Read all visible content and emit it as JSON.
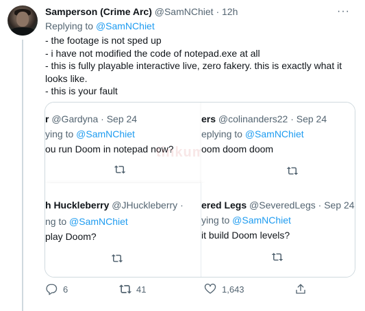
{
  "tweet": {
    "author_name": "Samperson (Crime Arc)",
    "author_handle": "@SamNChiet",
    "separator": "·",
    "time": "12h",
    "more": "···",
    "replying_prefix": "Replying to",
    "replying_mention": "@SamNChiet",
    "body_lines": [
      "- the footage is not sped up",
      "- i have not modified the code of notepad.exe at all",
      "- this is fully playable interactive live, zero fakery. this is exactly what it looks like.",
      "- this is your fault"
    ]
  },
  "media": {
    "watermark": "tinkum",
    "quotes": [
      {
        "author": "r",
        "handle": "@Gardyna",
        "date": "· Sep 24",
        "replying": "ying to",
        "mention": "@SamNChiet",
        "text": "ou run Doom in notepad now?"
      },
      {
        "author": "ers",
        "handle": "@colinanders22",
        "date": "· Sep 24",
        "replying": "eplying to",
        "mention": "@SamNChiet",
        "text": "oom doom doom"
      },
      {
        "author": "h Huckleberry",
        "handle": "@JHuckleberry",
        "date": "·",
        "replying": "ng to",
        "mention": "@SamNChiet",
        "text": " play Doom?"
      },
      {
        "author": "ered Legs",
        "handle": "@SeveredLegs",
        "date": "· Sep 24",
        "replying": "ying to",
        "mention": "@SamNChiet",
        "text": "it build Doom levels?"
      }
    ]
  },
  "actions": {
    "reply_count": "6",
    "retweet_count": "41",
    "like_count": "1,643",
    "icons": [
      "reply-icon",
      "retweet-icon",
      "like-icon",
      "share-icon"
    ]
  },
  "colors": {
    "link": "#1d9bf0",
    "secondary_text": "#536471",
    "border": "#cfd9de"
  }
}
